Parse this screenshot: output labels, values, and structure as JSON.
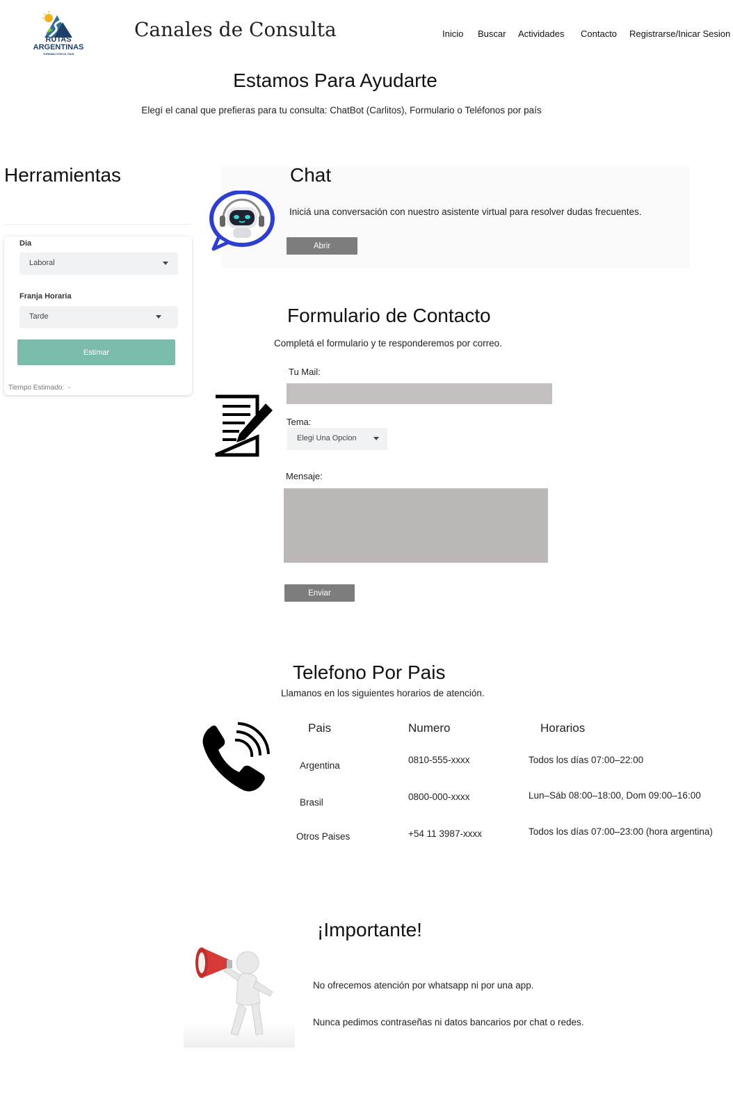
{
  "brand": {
    "logo_line1": "RUTAS",
    "logo_line2": "ARGENTINAS",
    "logo_tagline": "TURISMO POR EL PAIS",
    "title": "Canales de Consulta"
  },
  "nav": [
    "Inicio",
    "Buscar",
    "Actividades",
    "Contacto",
    "Registrarse/Inicar Sesion"
  ],
  "hero": {
    "title": "Estamos Para Ayudarte",
    "subtitle": "Elegí el canal que prefieras para tu consulta: ChatBot (Carlitos), Formulario o Teléfonos por país"
  },
  "tools": {
    "title": "Herramientas",
    "day_label": "Dia",
    "day_value": "Laboral",
    "slot_label": "Franja Horaria",
    "slot_value": "Tarde",
    "button": "Estimar",
    "estimate_label": "Tiempo Estimado:",
    "estimate_value": "-"
  },
  "chat": {
    "title": "Chat",
    "description": "Iniciá una conversación con nuestro asistente virtual para resolver dudas frecuentes.",
    "button": "Abrir"
  },
  "form": {
    "title": "Formulario de Contacto",
    "subtitle": "Completá el formulario y te responderemos por correo.",
    "mail_label": "Tu Mail:",
    "mail_value": "",
    "topic_label": "Tema:",
    "topic_value": "Elegi Una Opcion",
    "message_label": "Mensaje:",
    "message_value": "",
    "submit": "Enviar"
  },
  "phones": {
    "title": "Telefono Por Pais",
    "subtitle": "Llamanos en los siguientes horarios de atención.",
    "headers": [
      "Pais",
      "Numero",
      "Horarios"
    ],
    "rows": [
      {
        "country": "Argentina",
        "number": "0810-555-xxxx",
        "hours": "Todos los días 07:00–22:00"
      },
      {
        "country": "Brasil",
        "number": "0800-000-xxxx",
        "hours": "Lun–Sáb 08:00–18:00, Dom 09:00–16:00"
      },
      {
        "country": "Otros Paises",
        "number": "+54 11 3987-xxxx",
        "hours": "Todos los días 07:00–23:00 (hora argentina)"
      }
    ]
  },
  "important": {
    "title": "¡Importante!",
    "line1": "No ofrecemos atención por whatsapp ni por una app.",
    "line2": "Nunca pedimos contraseñas ni datos bancarios por chat o redes."
  },
  "icons": {
    "logo": "rutas-argentinas-logo",
    "chatbot": "robot-chat-icon",
    "form": "document-edit-icon",
    "phone": "phone-call-icon",
    "megaphone": "megaphone-figure-icon"
  },
  "colors": {
    "accent_green": "#7bbbab",
    "button_grey": "#7d7d7d",
    "input_grey": "#c3bfbf",
    "chat_blue": "#2e3fd0"
  }
}
